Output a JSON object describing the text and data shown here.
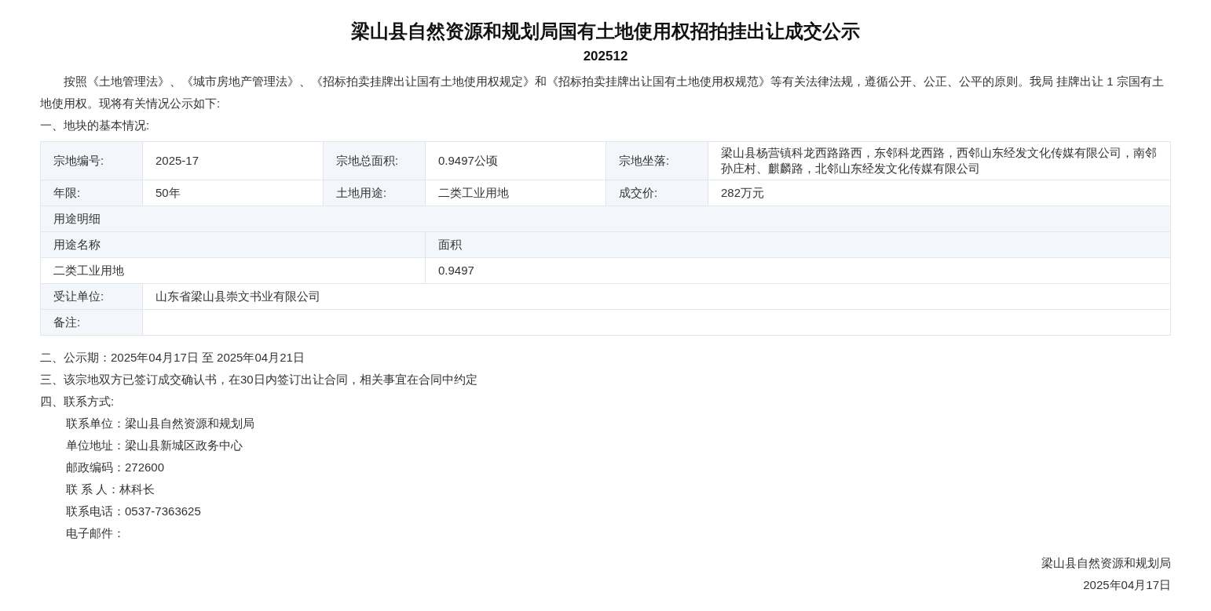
{
  "title": "梁山县自然资源和规划局国有土地使用权招拍挂出让成交公示",
  "subtitle": "202512",
  "intro": "按照《土地管理法》、《城市房地产管理法》、《招标拍卖挂牌出让国有土地使用权规定》和《招标拍卖挂牌出让国有土地使用权规范》等有关法律法规，遵循公开、公正、公平的原则。我局 挂牌出让 1 宗国有土地使用权。现将有关情况公示如下:",
  "section_1_heading": "一、地块的基本情况:",
  "land_table": {
    "basic_rows": [
      [
        {
          "label": "宗地编号:",
          "value": "2025-17"
        },
        {
          "label": "宗地总面积:",
          "value": "0.9497公顷"
        },
        {
          "label": "宗地坐落:",
          "value": "梁山县杨营镇科龙西路路西，东邻科龙西路，西邻山东经发文化传媒有限公司，南邻孙庄村、麒麟路，北邻山东经发文化传媒有限公司"
        }
      ],
      [
        {
          "label": "年限:",
          "value": "50年"
        },
        {
          "label": "土地用途:",
          "value": "二类工业用地"
        },
        {
          "label": "成交价:",
          "value": "282万元"
        }
      ]
    ],
    "usage_section_title": "用途明细",
    "usage_columns": [
      "用途名称",
      "面积"
    ],
    "usage_rows": [
      [
        "二类工业用地",
        "0.9497"
      ]
    ],
    "transferee": {
      "label": "受让单位:",
      "value": "山东省梁山县崇文书业有限公司"
    },
    "remarks": {
      "label": "备注:"
    }
  },
  "notice_period": "二、公示期：2025年04月17日 至 2025年04月21日",
  "contract_note": "三、该宗地双方已签订成交确认书，在30日内签订出让合同，相关事宜在合同中约定",
  "contact_heading": "四、联系方式:",
  "contacts": [
    "联系单位：梁山县自然资源和规划局",
    "单位地址：梁山县新城区政务中心",
    "邮政编码：272600",
    "联 系 人：林科长",
    "联系电话：0537-7363625",
    "电子邮件："
  ],
  "footer": {
    "issuer": "梁山县自然资源和规划局",
    "date": "2025年04月17日"
  }
}
